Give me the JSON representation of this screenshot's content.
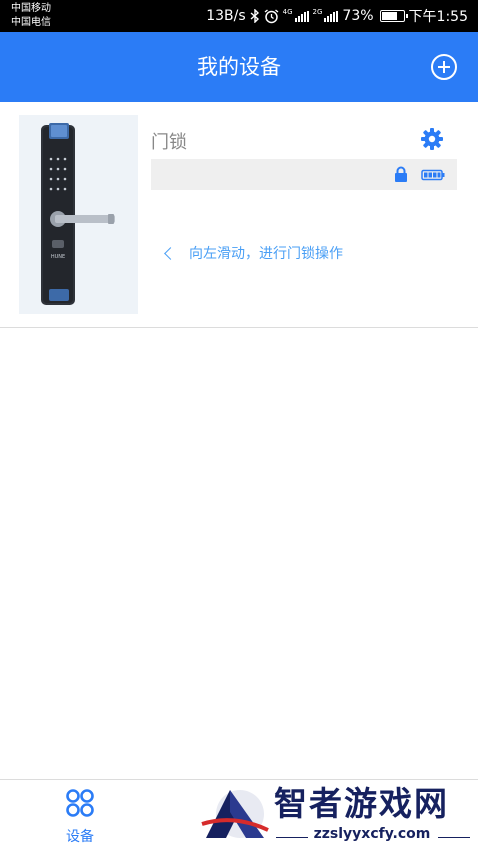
{
  "status_bar": {
    "carrier_1": "中国移动",
    "carrier_2": "中国电信",
    "net_speed": "13B/s",
    "net_1": "4G",
    "net_2": "2G",
    "battery": "73%",
    "battery_level": 0.73,
    "time": "下午1:55",
    "icons": [
      "bluetooth-icon",
      "alarm-icon",
      "signal-icon",
      "battery-icon"
    ]
  },
  "header": {
    "title": "我的设备",
    "add_icon": "plus-circle-icon"
  },
  "device": {
    "name": "门锁",
    "brand_text": "HUNE",
    "hint": "向左滑动，进行门锁操作",
    "icons": [
      "settings-gear-icon",
      "lock-icon",
      "battery-icon",
      "chevron-left-icon"
    ]
  },
  "bottom_nav": {
    "tabs": [
      {
        "label": "设备",
        "icon": "grid-icon",
        "active": true
      },
      {
        "label": "",
        "icon": "",
        "active": false
      },
      {
        "label": "",
        "icon": "",
        "active": false
      }
    ]
  },
  "watermark": {
    "title": "智者游戏网",
    "url": "zzslyyxcfy.com"
  },
  "colors": {
    "primary": "#2b7cf6",
    "hint": "#4a9ff5",
    "watermark": "#16215f"
  }
}
